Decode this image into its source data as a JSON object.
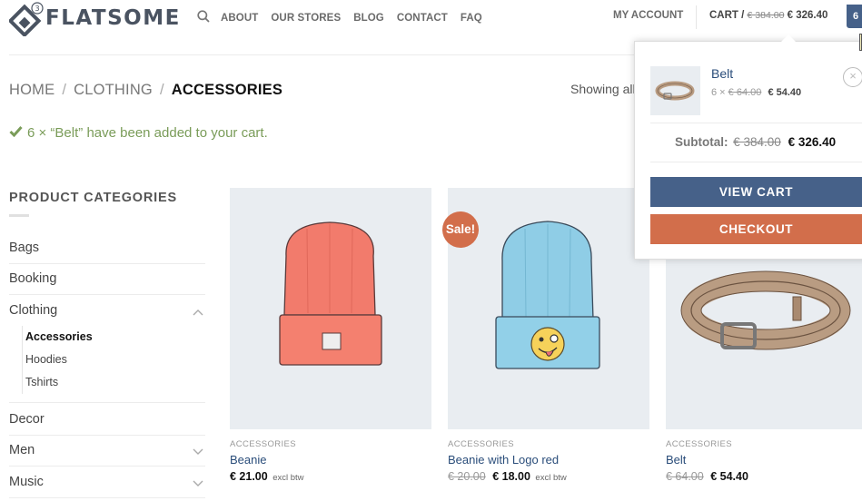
{
  "header": {
    "logo_text": "FLATSOME",
    "logo_badge": "3",
    "nav": [
      "ABOUT",
      "OUR STORES",
      "BLOG",
      "CONTACT",
      "FAQ"
    ],
    "account_label": "MY ACCOUNT",
    "cart_label": "CART /",
    "cart_old_total": "€ 384.00",
    "cart_new_total": "€ 326.40",
    "cart_count": "6"
  },
  "breadcrumb": {
    "items": [
      "HOME",
      "CLOTHING",
      "ACCESSORIES"
    ],
    "separator": "/"
  },
  "showing_text": "Showing all",
  "notice": {
    "text": "6 × “Belt” have been added to your cart."
  },
  "sidebar": {
    "title": "PRODUCT CATEGORIES",
    "categories": [
      "Bags",
      "Booking",
      "Clothing",
      "Decor",
      "Men",
      "Music"
    ],
    "subcategories": [
      "Accessories",
      "Hoodies",
      "Tshirts"
    ]
  },
  "products": [
    {
      "category": "ACCESSORIES",
      "name": "Beanie",
      "old_price": "",
      "price": "€ 21.00",
      "tax": "excl btw"
    },
    {
      "category": "ACCESSORIES",
      "name": "Beanie with Logo red",
      "old_price": "€ 20.00",
      "price": "€ 18.00",
      "tax": "excl btw",
      "badge": "Sale!"
    },
    {
      "category": "ACCESSORIES",
      "name": "Belt",
      "old_price": "€ 64.00",
      "price": "€ 54.40",
      "tax": ""
    }
  ],
  "mini_cart": {
    "item_name": "Belt",
    "item_qty": "6 ×",
    "item_old_price": "€ 64.00",
    "item_price": "€ 54.40",
    "remove_symbol": "×",
    "subtotal_label": "Subtotal:",
    "subtotal_old": "€ 384.00",
    "subtotal_new": "€ 326.40",
    "view_cart": "VIEW CART",
    "checkout": "CHECKOUT"
  },
  "colors": {
    "primary": "#466189",
    "secondary": "#d26e4b",
    "success": "#7a9c59",
    "link": "#2a4d7a"
  }
}
